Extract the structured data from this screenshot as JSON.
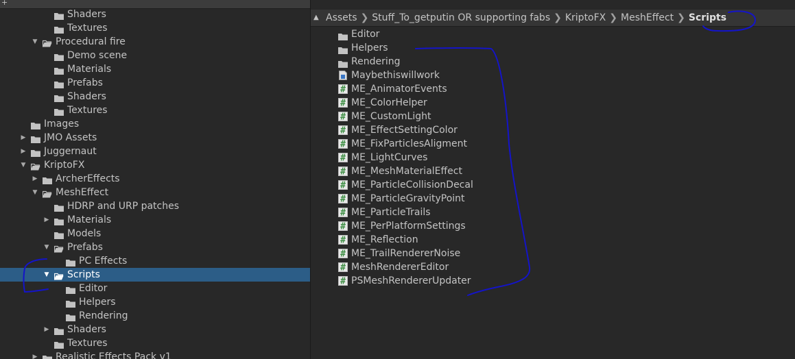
{
  "window": {
    "top_icon": "plus-icon",
    "back_icon": "caret-up-icon"
  },
  "tree": [
    {
      "label": "Shaders",
      "depth": 2,
      "arrow": "none"
    },
    {
      "label": "Textures",
      "depth": 2,
      "arrow": "none"
    },
    {
      "label": "Procedural fire",
      "depth": 1,
      "arrow": "expanded",
      "open": true
    },
    {
      "label": "Demo scene",
      "depth": 2,
      "arrow": "none"
    },
    {
      "label": "Materials",
      "depth": 2,
      "arrow": "none"
    },
    {
      "label": "Prefabs",
      "depth": 2,
      "arrow": "none"
    },
    {
      "label": "Shaders",
      "depth": 2,
      "arrow": "none"
    },
    {
      "label": "Textures",
      "depth": 2,
      "arrow": "none"
    },
    {
      "label": "Images",
      "depth": 0,
      "arrow": "none"
    },
    {
      "label": "JMO Assets",
      "depth": 0,
      "arrow": "collapsed"
    },
    {
      "label": "Juggernaut",
      "depth": 0,
      "arrow": "collapsed"
    },
    {
      "label": "KriptoFX",
      "depth": 0,
      "arrow": "expanded",
      "open": true
    },
    {
      "label": "ArcherEffects",
      "depth": 1,
      "arrow": "collapsed"
    },
    {
      "label": "MeshEffect",
      "depth": 1,
      "arrow": "expanded",
      "open": true
    },
    {
      "label": "HDRP and URP patches",
      "depth": 2,
      "arrow": "none"
    },
    {
      "label": "Materials",
      "depth": 2,
      "arrow": "collapsed"
    },
    {
      "label": "Models",
      "depth": 2,
      "arrow": "none"
    },
    {
      "label": "Prefabs",
      "depth": 2,
      "arrow": "expanded",
      "open": true
    },
    {
      "label": "PC Effects",
      "depth": 3,
      "arrow": "none"
    },
    {
      "label": "Scripts",
      "depth": 2,
      "arrow": "expanded",
      "open": true,
      "selected": true
    },
    {
      "label": "Editor",
      "depth": 3,
      "arrow": "none"
    },
    {
      "label": "Helpers",
      "depth": 3,
      "arrow": "none"
    },
    {
      "label": "Rendering",
      "depth": 3,
      "arrow": "none"
    },
    {
      "label": "Shaders",
      "depth": 2,
      "arrow": "collapsed"
    },
    {
      "label": "Textures",
      "depth": 2,
      "arrow": "none"
    },
    {
      "label": "Realistic Effects Pack v1",
      "depth": 1,
      "arrow": "collapsed"
    }
  ],
  "breadcrumb": [
    "Assets",
    "Stuff_To_getputin OR supporting fabs",
    "KriptoFX",
    "MeshEffect",
    "Scripts"
  ],
  "files": [
    {
      "label": "Editor",
      "type": "folder"
    },
    {
      "label": "Helpers",
      "type": "folder"
    },
    {
      "label": "Rendering",
      "type": "folder"
    },
    {
      "label": "Maybethiswillwork",
      "type": "asset"
    },
    {
      "label": "ME_AnimatorEvents",
      "type": "script"
    },
    {
      "label": "ME_ColorHelper",
      "type": "script"
    },
    {
      "label": "ME_CustomLight",
      "type": "script"
    },
    {
      "label": "ME_EffectSettingColor",
      "type": "script"
    },
    {
      "label": "ME_FixParticlesAligment",
      "type": "script"
    },
    {
      "label": "ME_LightCurves",
      "type": "script"
    },
    {
      "label": "ME_MeshMaterialEffect",
      "type": "script"
    },
    {
      "label": "ME_ParticleCollisionDecal",
      "type": "script"
    },
    {
      "label": "ME_ParticleGravityPoint",
      "type": "script"
    },
    {
      "label": "ME_ParticleTrails",
      "type": "script"
    },
    {
      "label": "ME_PerPlatformSettings",
      "type": "script"
    },
    {
      "label": "ME_Reflection",
      "type": "script"
    },
    {
      "label": "ME_TrailRendererNoise",
      "type": "script"
    },
    {
      "label": "MeshRendererEditor",
      "type": "script"
    },
    {
      "label": "PSMeshRendererUpdater",
      "type": "script"
    }
  ],
  "colors": {
    "background": "#282828",
    "selection": "#2c5d87",
    "folder": "#c2c2c2",
    "script_icon": "#3f8f45",
    "ink": "#1414c8"
  }
}
